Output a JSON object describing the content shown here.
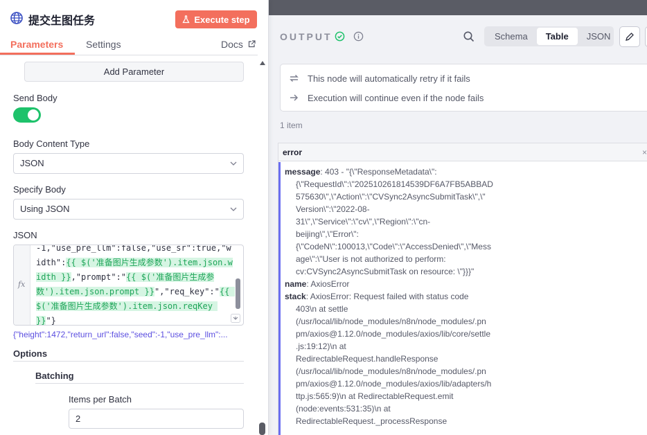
{
  "node": {
    "title": "提交生图任务",
    "execute_label": "Execute step",
    "tabs": [
      "Parameters",
      "Settings"
    ],
    "docs_label": "Docs"
  },
  "params": {
    "add_parameter": "Add Parameter",
    "send_body_label": "Send Body",
    "send_body_on": true,
    "body_content_type_label": "Body Content Type",
    "body_content_type_value": "JSON",
    "specify_body_label": "Specify Body",
    "specify_body_value": "Using JSON",
    "json_label": "JSON",
    "json_code": [
      {
        "parts": [
          {
            "t": "-1,\"use_pre_llm\":false,\"use_sr\":true,\"w",
            "expr": false
          }
        ]
      },
      {
        "parts": [
          {
            "t": "idth\":",
            "expr": false
          },
          {
            "t": "{{ $('准备图片生成参数').item.json.w",
            "expr": true
          }
        ]
      },
      {
        "parts": [
          {
            "t": "idth }}",
            "expr": true
          },
          {
            "t": ",\"prompt\":\"",
            "expr": false
          },
          {
            "t": "{{ $('准备图片生成参",
            "expr": true
          }
        ]
      },
      {
        "parts": [
          {
            "t": "数').item.json.prompt }}",
            "expr": true
          },
          {
            "t": "\",\"req_key\":\"",
            "expr": false
          },
          {
            "t": "{{ ",
            "expr": true
          }
        ]
      },
      {
        "parts": [
          {
            "t": "$('准备图片生成参数').item.json.reqKey ",
            "expr": true
          }
        ]
      },
      {
        "parts": [
          {
            "t": "}}",
            "expr": true
          },
          {
            "t": "\"}",
            "expr": false
          }
        ]
      }
    ],
    "json_preview": "{\"height\":1472,\"return_url\":false,\"seed\":-1,\"use_pre_llm\":...",
    "options_label": "Options",
    "batching_label": "Batching",
    "items_per_batch_label": "Items per Batch",
    "items_per_batch_value": "2"
  },
  "output": {
    "title": "OUTPUT",
    "views": [
      "Schema",
      "Table",
      "JSON"
    ],
    "active_view": "Table",
    "notices": [
      "This node will automatically retry if it fails",
      "Execution will continue even if the node fails"
    ],
    "item_count": "1 item",
    "column_header": "error",
    "message_key": "message",
    "message_lines": [
      ": 403 - \"{\\\"ResponseMetadata\\\":",
      "{\\\"RequestId\\\":\\\"202510261814539DF6A7FB5ABBAD",
      "575630\\\",\\\"Action\\\":\\\"CVSync2AsyncSubmitTask\\\",\\\"",
      "Version\\\":\\\"2022-08-",
      "31\\\",\\\"Service\\\":\\\"cv\\\",\\\"Region\\\":\\\"cn-",
      "beijing\\\",\\\"Error\\\":",
      "{\\\"CodeN\\\":100013,\\\"Code\\\":\\\"AccessDenied\\\",\\\"Mess",
      "age\\\":\\\"User is not authorized to perform:",
      "cv:CVSync2AsyncSubmitTask on resource: \\\"}}}\""
    ],
    "name_key": "name",
    "name_value": ": AxiosError",
    "stack_key": "stack",
    "stack_first": ": AxiosError: Request failed with status code",
    "stack_lines": [
      "403\\n    at settle",
      "(/usr/local/lib/node_modules/n8n/node_modules/.pn",
      "pm/axios@1.12.0/node_modules/axios/lib/core/settle",
      ".js:19:12)\\n    at",
      "RedirectableRequest.handleResponse",
      "(/usr/local/lib/node_modules/n8n/node_modules/.pn",
      "pm/axios@1.12.0/node_modules/axios/lib/adapters/h",
      "ttp.js:565:9)\\n    at RedirectableRequest.emit",
      "(node:events:531:35)\\n    at",
      "RedirectableRequest._processResponse"
    ]
  },
  "colors": {
    "accent": "#f36f5d",
    "toggle_on": "#1ec26b",
    "expression": "#1ea558",
    "error_bar": "#6a6ef0"
  }
}
